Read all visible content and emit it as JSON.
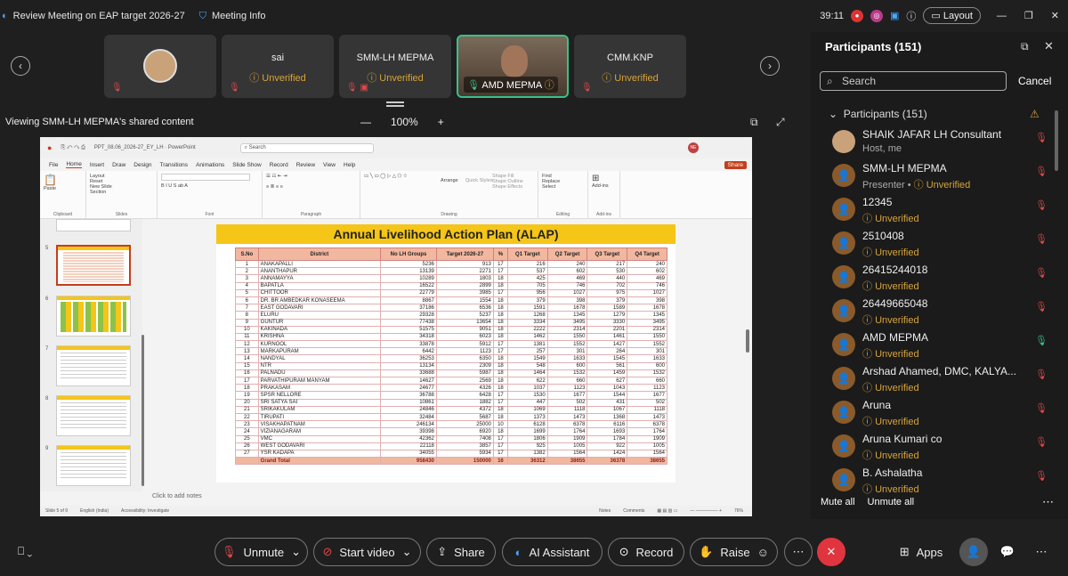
{
  "window": {
    "title": "Review Meeting on EAP target 2026-27",
    "meeting_info": "Meeting Info",
    "timer": "39:11",
    "layout": "Layout"
  },
  "strip": {
    "tiles": [
      {
        "name": "",
        "status": "",
        "kind": "avatar"
      },
      {
        "name": "sai",
        "status": "Unverified"
      },
      {
        "name": "SMM-LH MEPMA",
        "status": "Unverified"
      },
      {
        "name": "AMD MEPMA",
        "status": ""
      },
      {
        "name": "CMM.KNP",
        "status": "Unverified"
      }
    ]
  },
  "share": {
    "viewing": "Viewing SMM-LH MEPMA's shared content",
    "zoom": "100%",
    "minus": "—",
    "plus": "+"
  },
  "ppt": {
    "filename": "PPT_08.06_2026-27_EY_LH · PowerPoint",
    "search": "Search",
    "share_btn": "Share",
    "menu": [
      "File",
      "Home",
      "Insert",
      "Draw",
      "Design",
      "Transitions",
      "Animations",
      "Slide Show",
      "Record",
      "Review",
      "View",
      "Help"
    ],
    "groups": [
      "Clipboard",
      "Slides",
      "Font",
      "Paragraph",
      "Drawing",
      "Editing",
      "Add-ins"
    ],
    "ribbon_items": {
      "paste": "Paste",
      "new_slide": "New Slide",
      "layout": "Layout",
      "reset": "Reset",
      "section": "Section",
      "arrange": "Arrange",
      "quick_styles": "Quick Styles",
      "shape_fill": "Shape Fill",
      "shape_outline": "Shape Outline",
      "shape_effects": "Shape Effects",
      "find": "Find",
      "replace": "Replace",
      "select": "Select",
      "addins": "Add-ins"
    },
    "thumb_numbers": [
      "5",
      "6",
      "7",
      "8",
      "9"
    ],
    "notes": "Click to add notes",
    "status": {
      "slide": "Slide 5 of 9",
      "lang": "English (India)",
      "access": "Accessibility: Investigate",
      "notes": "Notes",
      "comments": "Comments",
      "zoom": "76%"
    }
  },
  "slide": {
    "title": "Annual Livelihood Action Plan (ALAP)",
    "headers": [
      "S.No",
      "District",
      "No LH Groups",
      "Target 2026-27",
      "%",
      "Q1 Target",
      "Q2 Target",
      "Q3 Target",
      "Q4 Target"
    ],
    "rows": [
      [
        "1",
        "ANAKAPALLI",
        "5236",
        "913",
        "17",
        "216",
        "240",
        "217",
        "240"
      ],
      [
        "2",
        "ANANTHAPUR",
        "13139",
        "2271",
        "17",
        "537",
        "602",
        "530",
        "602"
      ],
      [
        "3",
        "ANNAMAYYA",
        "10289",
        "1803",
        "18",
        "425",
        "469",
        "440",
        "469"
      ],
      [
        "4",
        "BAPATLA",
        "16522",
        "2899",
        "18",
        "705",
        "746",
        "702",
        "746"
      ],
      [
        "5",
        "CHITTOOR",
        "22779",
        "3985",
        "17",
        "956",
        "1027",
        "975",
        "1027"
      ],
      [
        "6",
        "DR. BR AMBEDKAR KONASEEMA",
        "8867",
        "1554",
        "18",
        "379",
        "398",
        "379",
        "398"
      ],
      [
        "7",
        "EAST GODAVARI",
        "37186",
        "6536",
        "18",
        "1591",
        "1678",
        "1589",
        "1678"
      ],
      [
        "8",
        "ELURU",
        "29328",
        "5237",
        "18",
        "1268",
        "1345",
        "1279",
        "1345"
      ],
      [
        "9",
        "GUNTUR",
        "77438",
        "13654",
        "18",
        "3334",
        "3495",
        "3330",
        "3495"
      ],
      [
        "10",
        "KAKINADA",
        "51575",
        "9051",
        "18",
        "2222",
        "2314",
        "2201",
        "2314"
      ],
      [
        "11",
        "KRISHNA",
        "34318",
        "6023",
        "18",
        "1462",
        "1550",
        "1461",
        "1550"
      ],
      [
        "12",
        "KURNOOL",
        "33878",
        "5912",
        "17",
        "1381",
        "1552",
        "1427",
        "1552"
      ],
      [
        "13",
        "MARKAPURAM",
        "6442",
        "1123",
        "17",
        "257",
        "301",
        "264",
        "301"
      ],
      [
        "14",
        "NANDYAL",
        "36253",
        "6350",
        "18",
        "1549",
        "1633",
        "1545",
        "1633"
      ],
      [
        "15",
        "NTR",
        "13134",
        "2309",
        "18",
        "548",
        "600",
        "561",
        "600"
      ],
      [
        "16",
        "PALNADU",
        "33688",
        "5987",
        "18",
        "1464",
        "1532",
        "1459",
        "1532"
      ],
      [
        "17",
        "PARVATHIPURAM MANYAM",
        "14627",
        "2569",
        "18",
        "622",
        "660",
        "627",
        "660"
      ],
      [
        "18",
        "PRAKASAM",
        "24677",
        "4326",
        "18",
        "1037",
        "1123",
        "1043",
        "1123"
      ],
      [
        "19",
        "SPSR NELLORE",
        "36788",
        "6428",
        "17",
        "1530",
        "1677",
        "1544",
        "1677"
      ],
      [
        "20",
        "SRI SATYA SAI",
        "10861",
        "1882",
        "17",
        "447",
        "502",
        "431",
        "502"
      ],
      [
        "21",
        "SRIKAKULAM",
        "24846",
        "4372",
        "18",
        "1069",
        "1118",
        "1067",
        "1118"
      ],
      [
        "22",
        "TIRUPATI",
        "32484",
        "5687",
        "18",
        "1373",
        "1473",
        "1368",
        "1473"
      ],
      [
        "23",
        "VISAKHAPATNAM",
        "246134",
        "25000",
        "10",
        "6128",
        "6378",
        "6116",
        "6378"
      ],
      [
        "24",
        "VIZIANAGARAM",
        "39398",
        "6920",
        "18",
        "1699",
        "1764",
        "1693",
        "1764"
      ],
      [
        "25",
        "VMC",
        "42362",
        "7408",
        "17",
        "1806",
        "1909",
        "1784",
        "1909"
      ],
      [
        "26",
        "WEST GODAVARI",
        "22118",
        "3857",
        "17",
        "925",
        "1005",
        "922",
        "1005"
      ],
      [
        "27",
        "YSR KADAPA",
        "34055",
        "5934",
        "17",
        "1382",
        "1564",
        "1424",
        "1564"
      ]
    ],
    "total": [
      "",
      "Grand Total",
      "958430",
      "150000",
      "16",
      "36312",
      "38655",
      "36378",
      "38655"
    ]
  },
  "panel": {
    "title": "Participants (151)",
    "search_placeholder": "Search",
    "cancel": "Cancel",
    "section": "Participants (151)",
    "people": [
      {
        "name": "SHAIK JAFAR LH Consultant",
        "status": "Host, me",
        "role": "",
        "avatar": "photo"
      },
      {
        "name": "SMM-LH MEPMA",
        "status": "Unverified",
        "role": "Presenter •"
      },
      {
        "name": "12345",
        "status": "Unverified",
        "role": ""
      },
      {
        "name": "2510408",
        "status": "Unverified",
        "role": ""
      },
      {
        "name": "26415244018",
        "status": "Unverified",
        "role": ""
      },
      {
        "name": "26449665048",
        "status": "Unverified",
        "role": ""
      },
      {
        "name": "AMD MEPMA",
        "status": "Unverified",
        "role": ""
      },
      {
        "name": "Arshad Ahamed, DMC, KALYA...",
        "status": "Unverified",
        "role": ""
      },
      {
        "name": "Aruna",
        "status": "Unverified",
        "role": ""
      },
      {
        "name": "Aruna Kumari co",
        "status": "Unverified",
        "role": ""
      },
      {
        "name": "B. Ashalatha",
        "status": "Unverified",
        "role": ""
      }
    ],
    "mute_all": "Mute all",
    "unmute_all": "Unmute all"
  },
  "controls": {
    "unmute": "Unmute",
    "start_video": "Start video",
    "share": "Share",
    "ai": "AI Assistant",
    "record": "Record",
    "raise": "Raise",
    "apps": "Apps"
  }
}
